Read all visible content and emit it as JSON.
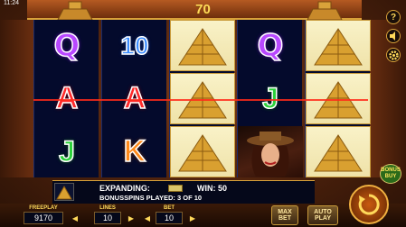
{
  "status": {
    "clock": "11:24"
  },
  "header": {
    "win_total": "70"
  },
  "reels": [
    [
      "sym-q",
      "sym-a",
      "sym-j"
    ],
    [
      "sym-10",
      "sym-a",
      "sym-k"
    ],
    [
      "pyramid",
      "pyramid",
      "pyramid"
    ],
    [
      "sym-q",
      "sym-j",
      "woman"
    ],
    [
      "pyramid",
      "pyramid",
      "pyramid"
    ]
  ],
  "symbols": {
    "q": "Q",
    "ten": "10",
    "a": "A",
    "j": "J",
    "k": "K"
  },
  "info": {
    "expanding_label": "EXPANDING:",
    "win_label": "WIN: 50",
    "bonus_spins": "BONUSSPINS PLAYED: 3 OF 10"
  },
  "bottom": {
    "freeplay_label": "FREEPLAY",
    "freeplay_value": "9170",
    "lines_label": "LINES",
    "lines_value": "10",
    "bet_label": "BET",
    "bet_value": "10",
    "max_bet": "MAX BET",
    "autoplay": "AUTO PLAY",
    "bonus_buy": "BONUS BUY"
  },
  "controls": {
    "help": "?",
    "sound": "sound-icon",
    "settings": "gear-icon",
    "spin": "spin-icon"
  },
  "colors": {
    "accent_gold": "#ffd95a",
    "reel_bg": "#040a2c",
    "payline_red": "#ff2a1a"
  }
}
